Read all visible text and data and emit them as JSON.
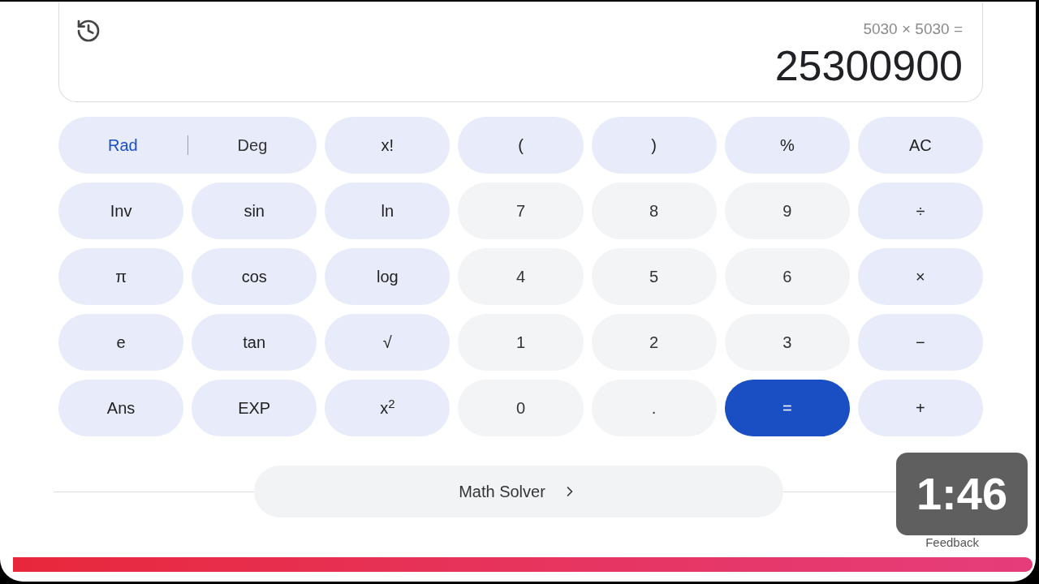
{
  "display": {
    "expression": "5030 × 5030 =",
    "result": "25300900"
  },
  "keys": [
    [
      {
        "kind": "toggle",
        "options": [
          {
            "label": "Rad",
            "selected": true
          },
          {
            "label": "Deg",
            "selected": false
          }
        ]
      },
      {
        "kind": "function",
        "label": "x!"
      },
      {
        "kind": "function",
        "label": "("
      },
      {
        "kind": "function",
        "label": ")"
      },
      {
        "kind": "function",
        "label": "%"
      },
      {
        "kind": "function",
        "label": "AC"
      }
    ],
    [
      {
        "kind": "function",
        "label": "Inv"
      },
      {
        "kind": "function",
        "label": "sin"
      },
      {
        "kind": "function",
        "label": "ln"
      },
      {
        "kind": "digit",
        "label": "7"
      },
      {
        "kind": "digit",
        "label": "8"
      },
      {
        "kind": "digit",
        "label": "9"
      },
      {
        "kind": "function",
        "label": "÷"
      }
    ],
    [
      {
        "kind": "function",
        "label": "π"
      },
      {
        "kind": "function",
        "label": "cos"
      },
      {
        "kind": "function",
        "label": "log"
      },
      {
        "kind": "digit",
        "label": "4"
      },
      {
        "kind": "digit",
        "label": "5"
      },
      {
        "kind": "digit",
        "label": "6"
      },
      {
        "kind": "function",
        "label": "×"
      }
    ],
    [
      {
        "kind": "function",
        "label": "e"
      },
      {
        "kind": "function",
        "label": "tan"
      },
      {
        "kind": "function",
        "label": "√"
      },
      {
        "kind": "digit",
        "label": "1"
      },
      {
        "kind": "digit",
        "label": "2"
      },
      {
        "kind": "digit",
        "label": "3"
      },
      {
        "kind": "function",
        "label": "−"
      }
    ],
    [
      {
        "kind": "function",
        "label": "Ans"
      },
      {
        "kind": "function",
        "label": "EXP"
      },
      {
        "kind": "function",
        "label": "x$^{2}$"
      },
      {
        "kind": "digit",
        "label": "0"
      },
      {
        "kind": "digit",
        "label": "."
      },
      {
        "kind": "equals",
        "label": "="
      },
      {
        "kind": "function",
        "label": "+"
      }
    ]
  ],
  "math_solver": {
    "label": "Math Solver"
  },
  "feedback": "Feedback",
  "video": {
    "duration": "1:46",
    "progress": {
      "level": 1
    }
  }
}
